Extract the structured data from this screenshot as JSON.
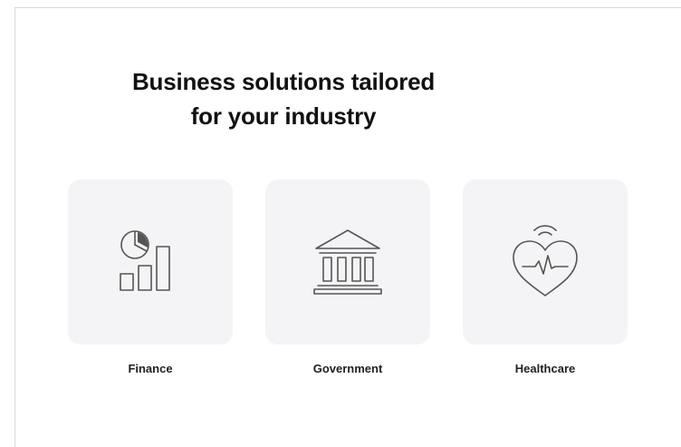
{
  "heading": {
    "line1": "Business solutions tailored",
    "line2": "for your industry"
  },
  "industries": [
    {
      "label": "Finance",
      "icon": "finance-chart-icon"
    },
    {
      "label": "Government",
      "icon": "government-building-icon"
    },
    {
      "label": "Healthcare",
      "icon": "heart-pulse-icon"
    }
  ],
  "colors": {
    "card_background": "#f4f4f6",
    "icon_stroke": "#555555",
    "text": "#111111"
  }
}
